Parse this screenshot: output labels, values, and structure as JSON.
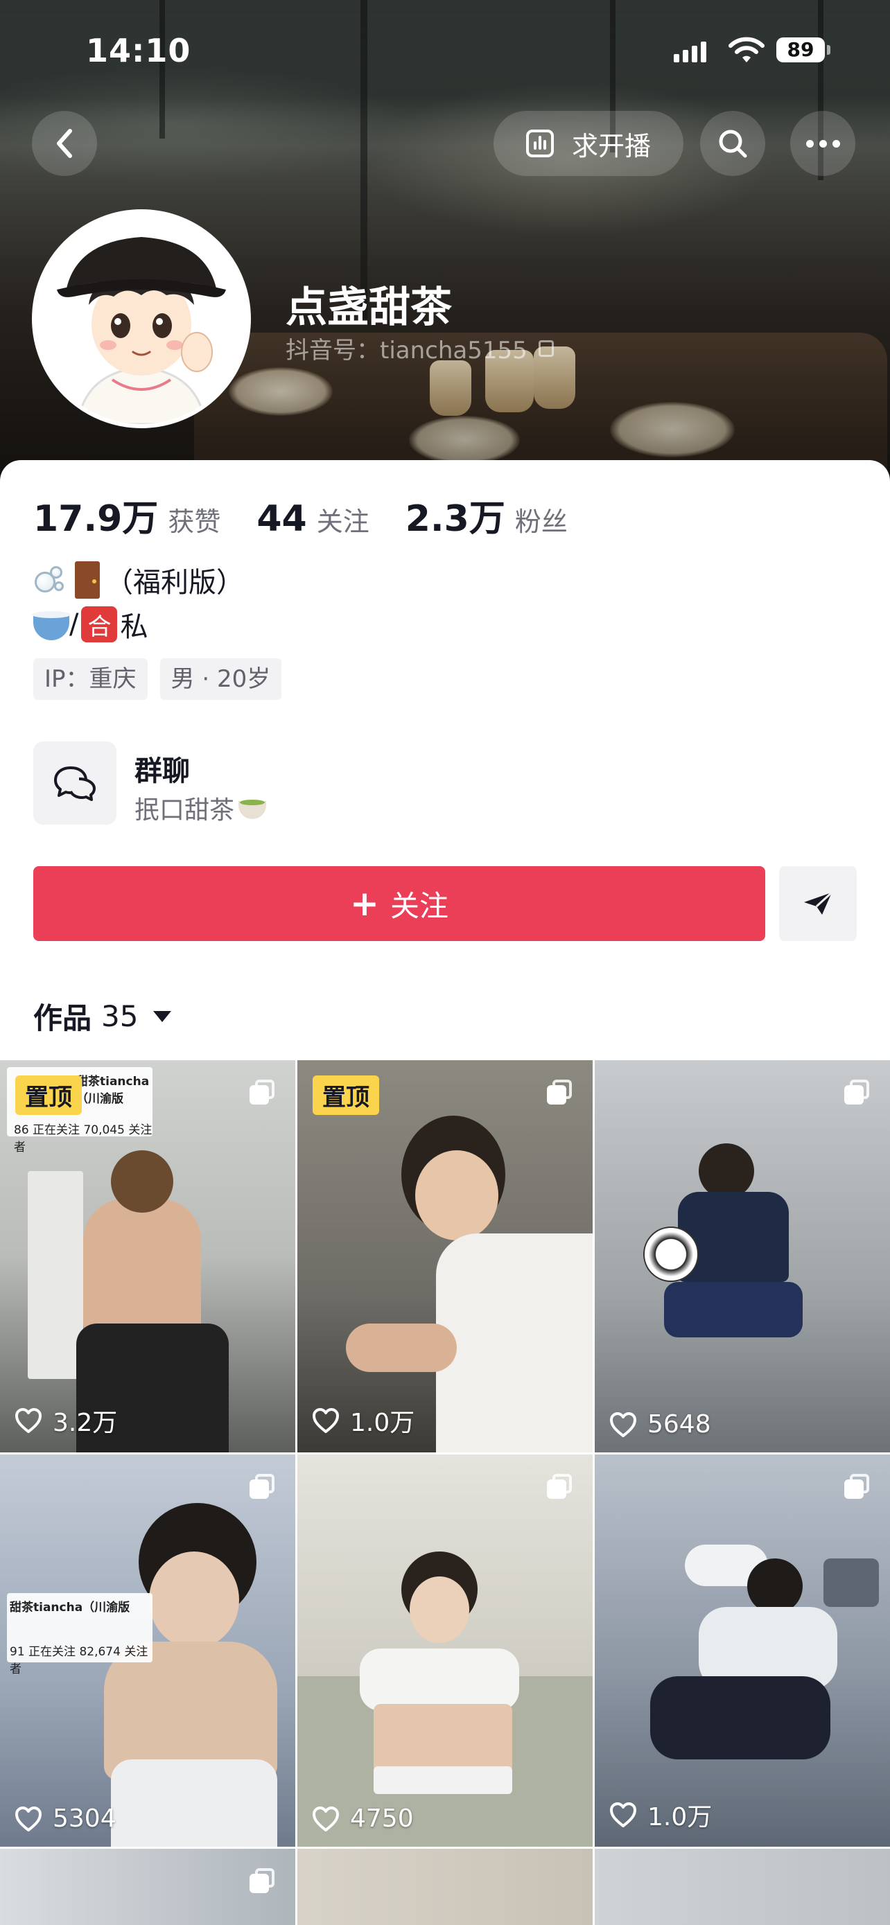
{
  "status_bar": {
    "time": "14:10",
    "battery": "89"
  },
  "nav": {
    "live_label": "求开播"
  },
  "profile": {
    "name": "点盏甜茶",
    "douyin_id": "抖音号：tiancha5155",
    "stats": [
      {
        "value": "17.9万",
        "label": "获赞"
      },
      {
        "value": "44",
        "label": "关注"
      },
      {
        "value": "2.3万",
        "label": "粉丝"
      }
    ],
    "bio_line1": "（福利版）",
    "bio_line2_sep": "/",
    "bio_line2_badge": "合",
    "bio_line2_text": "私",
    "tags": [
      "IP：重庆",
      "男 · 20岁"
    ]
  },
  "group_chat": {
    "title": "群聊",
    "subtitle": "抿口甜茶"
  },
  "actions": {
    "follow_label": "关注",
    "follow_plus": "+"
  },
  "works": {
    "title": "作品",
    "count": "35"
  },
  "grid": [
    {
      "pinned": true,
      "pin_label": "置顶",
      "likes": "3.2万",
      "overlay": {
        "title": "甜茶tiancha（川渝版",
        "line": "86 正在关注  70,045 关注者"
      }
    },
    {
      "pinned": true,
      "pin_label": "置顶",
      "likes": "1.0万"
    },
    {
      "pinned": false,
      "likes": "5648"
    },
    {
      "pinned": false,
      "likes": "5304",
      "overlay": {
        "title": "甜茶tiancha（川渝版",
        "line": "91 正在关注  82,674 关注者"
      }
    },
    {
      "pinned": false,
      "likes": "4750"
    },
    {
      "pinned": false,
      "likes": "1.0万"
    }
  ],
  "colors": {
    "accent": "#ea3f57",
    "pin": "#fbd44e"
  }
}
